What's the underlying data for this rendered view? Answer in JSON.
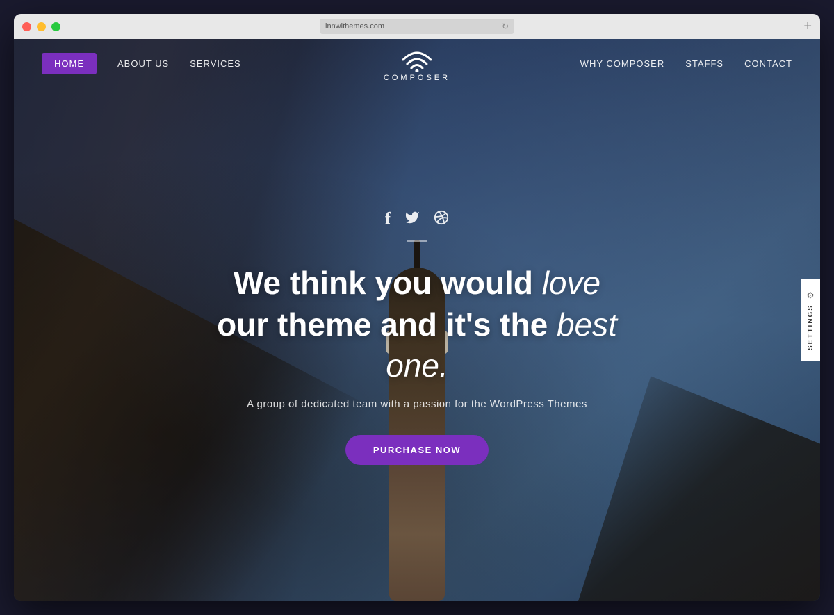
{
  "window": {
    "url": "innwithemes.com"
  },
  "navbar": {
    "logo_text": "COMPOSER",
    "nav_items_left": [
      {
        "id": "home",
        "label": "HOME",
        "active": true
      },
      {
        "id": "about",
        "label": "ABOUT US",
        "active": false
      },
      {
        "id": "services",
        "label": "SERVICES",
        "active": false
      }
    ],
    "nav_items_right": [
      {
        "id": "why-composer",
        "label": "WHY COMPOSER",
        "active": false
      },
      {
        "id": "staffs",
        "label": "STAFFS",
        "active": false
      },
      {
        "id": "contact",
        "label": "CONTACT",
        "active": false
      }
    ]
  },
  "hero": {
    "social": {
      "facebook": "f",
      "twitter": "🐦",
      "dribbble": "⊛"
    },
    "headline_part1": "We think you would ",
    "headline_italic1": "love",
    "headline_part2": "our theme and it's the ",
    "headline_italic2": "best",
    "headline_part3": "one.",
    "subtitle": "A group of dedicated team with a passion for the WordPress Themes",
    "cta_button": "PURCHASE NOW"
  },
  "settings_tab": {
    "label": "SETTINGS"
  },
  "colors": {
    "accent_purple": "#7b2fbe",
    "nav_bg": "transparent",
    "hero_overlay": "rgba(30,40,70,0.65)"
  }
}
